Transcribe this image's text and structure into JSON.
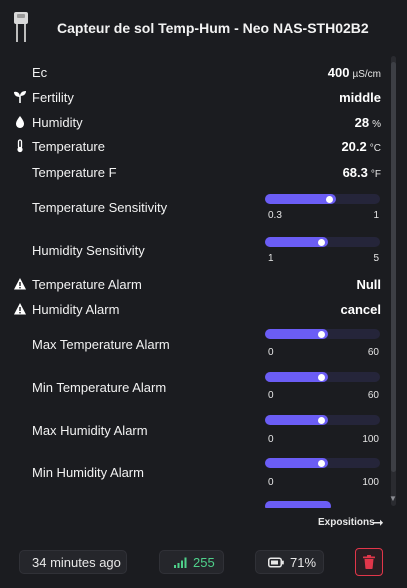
{
  "header": {
    "title": "Capteur de sol Temp-Hum - Neo NAS-STH02B2",
    "device_icon": "soil-sensor-icon"
  },
  "rows": {
    "ec": {
      "label": "Ec",
      "value": "400",
      "unit": "µS/cm"
    },
    "fertility": {
      "label": "Fertility",
      "value": "middle",
      "icon": "sprout-icon"
    },
    "humidity": {
      "label": "Humidity",
      "value": "28",
      "unit": "%",
      "icon": "water-drop-icon"
    },
    "temperature": {
      "label": "Temperature",
      "value": "20.2",
      "unit": "°C",
      "icon": "thermometer-icon"
    },
    "temperature_f": {
      "label": "Temperature F",
      "value": "68.3",
      "unit": "°F"
    },
    "temp_sensitivity": {
      "label": "Temperature Sensitivity",
      "min": "0.3",
      "max": "1",
      "level": 0.62
    },
    "hum_sensitivity": {
      "label": "Humidity Sensitivity",
      "min": "1",
      "max": "5",
      "level": 0.55
    },
    "temp_alarm": {
      "label": "Temperature Alarm",
      "value": "Null",
      "icon": "warning-icon"
    },
    "hum_alarm": {
      "label": "Humidity Alarm",
      "value": "cancel",
      "icon": "warning-icon"
    },
    "max_temp_alarm": {
      "label": "Max Temperature Alarm",
      "min": "0",
      "max": "60",
      "level": 0.55
    },
    "min_temp_alarm": {
      "label": "Min Temperature Alarm",
      "min": "0",
      "max": "60",
      "level": 0.55
    },
    "max_hum_alarm": {
      "label": "Max Humidity Alarm",
      "min": "0",
      "max": "100",
      "level": 0.55
    },
    "min_hum_alarm": {
      "label": "Min Humidity Alarm",
      "min": "0",
      "max": "100",
      "level": 0.55
    }
  },
  "expositions": {
    "label": "Expositions",
    "icon": "arrow-right-icon"
  },
  "footer": {
    "last_seen": "34 minutes ago",
    "signal": {
      "value": "255",
      "icon": "signal-bars-icon",
      "color": "#4fd18b"
    },
    "battery": {
      "value": "71%",
      "icon": "battery-icon"
    },
    "delete_icon": "trash-icon",
    "accent": "#6b5df5",
    "danger": "#e2364a"
  }
}
